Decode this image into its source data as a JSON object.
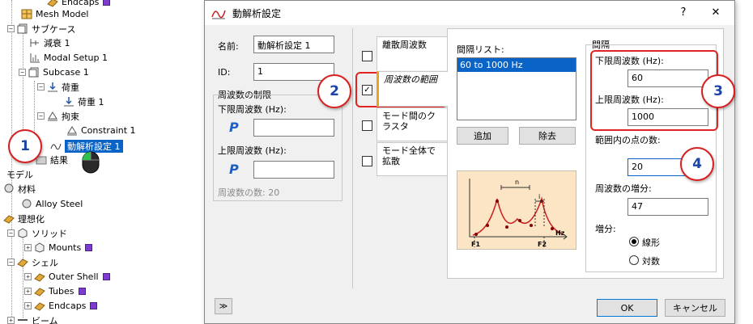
{
  "tree": {
    "items": [
      {
        "label": "Endcaps",
        "swatch": true
      },
      {
        "label": "Mesh Model"
      },
      {
        "label": "サブケース"
      },
      {
        "label": "減衰 1"
      },
      {
        "label": "Modal Setup 1"
      },
      {
        "label": "Subcase 1"
      },
      {
        "label": "荷重"
      },
      {
        "label": "荷重 1"
      },
      {
        "label": "拘束"
      },
      {
        "label": "Constraint 1"
      },
      {
        "label": "動解析設定 1"
      },
      {
        "label": "結果"
      },
      {
        "label": "モデル"
      },
      {
        "label": "材料"
      },
      {
        "label": "Alloy Steel"
      },
      {
        "label": "理想化"
      },
      {
        "label": "ソリッド"
      },
      {
        "label": "Mounts",
        "swatch": true
      },
      {
        "label": "シェル"
      },
      {
        "label": "Outer Shell",
        "swatch": true
      },
      {
        "label": "Tubes",
        "swatch": true
      },
      {
        "label": "Endcaps",
        "swatch": true
      },
      {
        "label": "ビーム"
      }
    ]
  },
  "callouts": [
    "1",
    "2",
    "3",
    "4"
  ],
  "dialog": {
    "title": "動解析設定",
    "help": "?",
    "close": "✕",
    "name_label": "名前:",
    "name_value": "動解析設定 1",
    "id_label": "ID:",
    "id_value": "1",
    "freq_limit_title": "周波数の制限",
    "lower_freq_label": "下限周波数 (Hz):",
    "upper_freq_label": "上限周波数 (Hz):",
    "p_symbol": "P",
    "freq_count_label": "周波数の数: 20",
    "tabs": [
      {
        "label": "離散周波数",
        "checked": false
      },
      {
        "label": "周波数の範囲",
        "checked": true
      },
      {
        "label": "モード間のクラスタ",
        "checked": false
      },
      {
        "label": "モード全体で拡散",
        "checked": false
      }
    ],
    "interval_list_label": "間隔リスト:",
    "interval_items": [
      "60 to 1000 Hz"
    ],
    "add_button": "追加",
    "remove_button": "除去",
    "interval_title": "間隔",
    "interval_lower_label": "下限周波数 (Hz):",
    "interval_lower_value": "60",
    "interval_upper_label": "上限周波数 (Hz):",
    "interval_upper_value": "1000",
    "points_label": "範囲内の点の数:",
    "points_value": "20",
    "increment_label": "周波数の増分:",
    "increment_value": "47",
    "increment_type_label": "増分:",
    "radio_linear": "線形",
    "radio_log": "対数",
    "diagram": {
      "n": "n",
      "i": "i",
      "f1": "F1",
      "f2": "F2",
      "hz": "Hz"
    },
    "expand_button": "≫",
    "ok_button": "OK",
    "cancel_button": "キャンセル"
  }
}
